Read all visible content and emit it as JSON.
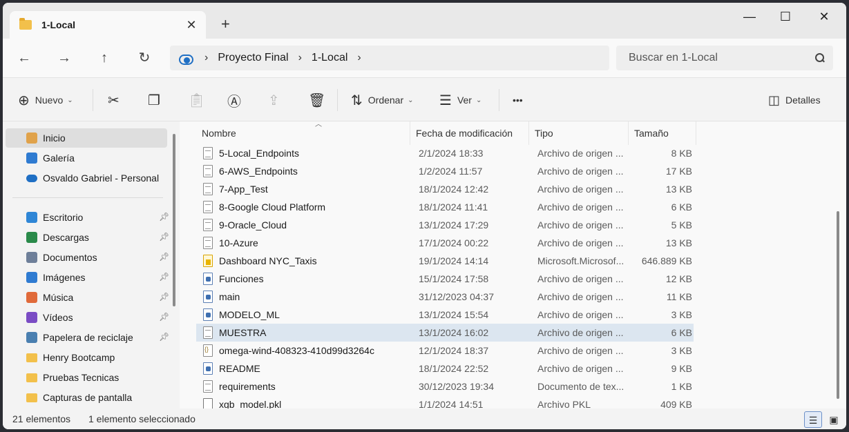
{
  "window": {
    "tab_title": "1-Local",
    "tab_close": "✕",
    "new_tab": "+",
    "minimize": "—",
    "maximize": "☐",
    "close": "✕"
  },
  "nav": {
    "back": "←",
    "forward": "→",
    "up": "↑",
    "refresh": "↻",
    "breadcrumbs": [
      "Proyecto Final",
      "1-Local"
    ],
    "search_placeholder": "Buscar en 1-Local"
  },
  "toolbar": {
    "new_label": "Nuevo",
    "sort_label": "Ordenar",
    "view_label": "Ver",
    "more": "•••",
    "details_label": "Detalles"
  },
  "sidebar": {
    "items": [
      {
        "label": "Inicio",
        "icon": "home-icon",
        "active": true
      },
      {
        "label": "Galería",
        "icon": "gallery-icon"
      },
      {
        "label": "Osvaldo Gabriel - Personal",
        "icon": "onedrive-cloud-icon"
      }
    ],
    "quick_access": [
      {
        "label": "Escritorio",
        "icon": "desktop-icon",
        "pinned": true
      },
      {
        "label": "Descargas",
        "icon": "download-icon",
        "pinned": true
      },
      {
        "label": "Documentos",
        "icon": "documents-icon",
        "pinned": true
      },
      {
        "label": "Imágenes",
        "icon": "pictures-icon",
        "pinned": true
      },
      {
        "label": "Música",
        "icon": "music-icon",
        "pinned": true
      },
      {
        "label": "Vídeos",
        "icon": "videos-icon",
        "pinned": true
      },
      {
        "label": "Papelera de reciclaje",
        "icon": "recycle-bin-icon",
        "pinned": true
      },
      {
        "label": "Henry Bootcamp",
        "icon": "folder-icon",
        "pinned": false
      },
      {
        "label": "Pruebas Tecnicas",
        "icon": "folder-icon",
        "pinned": false
      },
      {
        "label": "Capturas de pantalla",
        "icon": "folder-icon",
        "pinned": false
      }
    ]
  },
  "list": {
    "columns": [
      "Nombre",
      "Fecha de modificación",
      "Tipo",
      "Tamaño"
    ],
    "rows": [
      {
        "name": "5-Local_Endpoints",
        "date": "2/1/2024 18:33",
        "type": "Archivo de origen ...",
        "size": "8 KB",
        "icon": "txt"
      },
      {
        "name": "6-AWS_Endpoints",
        "date": "1/2/2024 11:57",
        "type": "Archivo de origen ...",
        "size": "17 KB",
        "icon": "txt"
      },
      {
        "name": "7-App_Test",
        "date": "18/1/2024 12:42",
        "type": "Archivo de origen ...",
        "size": "13 KB",
        "icon": "txt"
      },
      {
        "name": "8-Google Cloud Platform",
        "date": "18/1/2024 11:41",
        "type": "Archivo de origen ...",
        "size": "6 KB",
        "icon": "txt"
      },
      {
        "name": "9-Oracle_Cloud",
        "date": "13/1/2024 17:29",
        "type": "Archivo de origen ...",
        "size": "5 KB",
        "icon": "txt"
      },
      {
        "name": "10-Azure",
        "date": "17/1/2024 00:22",
        "type": "Archivo de origen ...",
        "size": "13 KB",
        "icon": "txt"
      },
      {
        "name": "Dashboard NYC_Taxis",
        "date": "19/1/2024 14:14",
        "type": "Microsoft.Microsof...",
        "size": "646.889 KB",
        "icon": "pbix"
      },
      {
        "name": "Funciones",
        "date": "15/1/2024 17:58",
        "type": "Archivo de origen ...",
        "size": "12 KB",
        "icon": "py"
      },
      {
        "name": "main",
        "date": "31/12/2023 04:37",
        "type": "Archivo de origen ...",
        "size": "11 KB",
        "icon": "py"
      },
      {
        "name": "MODELO_ML",
        "date": "13/1/2024 15:54",
        "type": "Archivo de origen ...",
        "size": "3 KB",
        "icon": "py"
      },
      {
        "name": "MUESTRA",
        "date": "13/1/2024 16:02",
        "type": "Archivo de origen ...",
        "size": "6 KB",
        "icon": "txt",
        "selected": true
      },
      {
        "name": "omega-wind-408323-410d99d3264c",
        "date": "12/1/2024 18:37",
        "type": "Archivo de origen ...",
        "size": "3 KB",
        "icon": "json"
      },
      {
        "name": "README",
        "date": "18/1/2024 22:52",
        "type": "Archivo de origen ...",
        "size": "9 KB",
        "icon": "py"
      },
      {
        "name": "requirements",
        "date": "30/12/2023 19:34",
        "type": "Documento de tex...",
        "size": "1 KB",
        "icon": "txt"
      },
      {
        "name": "xgb_model.pkl",
        "date": "1/1/2024 14:51",
        "type": "Archivo PKL",
        "size": "409 KB",
        "icon": "pkl"
      }
    ]
  },
  "status": {
    "count": "21 elementos",
    "selection": "1 elemento seleccionado"
  }
}
